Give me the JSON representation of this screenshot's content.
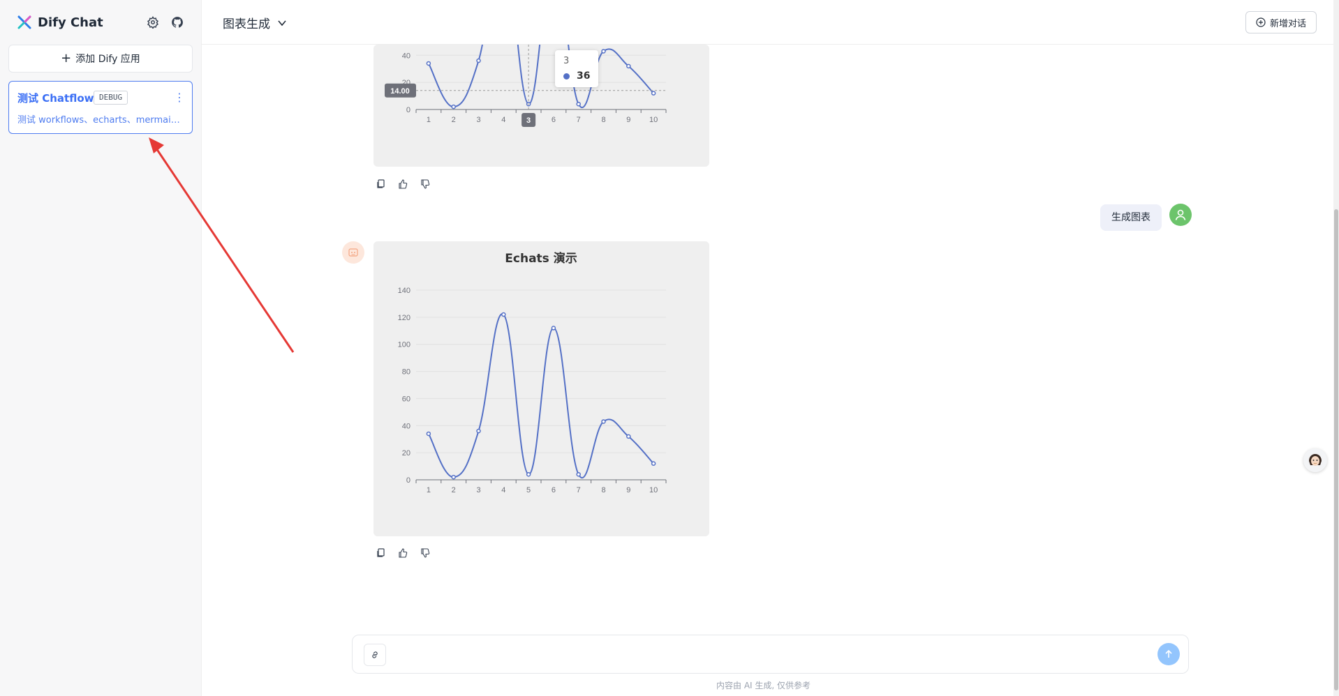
{
  "sidebar": {
    "brand": "Dify Chat",
    "settings_icon": "gear-icon",
    "github_icon": "github-icon",
    "add_app_label": "添加 Dify 应用",
    "app": {
      "title": "测试 Chatflow",
      "badge": "DEBUG",
      "description": "测试 workflows、echarts、mermaid ..."
    }
  },
  "header": {
    "conversation_title": "图表生成",
    "new_chat_label": "新增对话"
  },
  "messages": {
    "user_message": "生成图表"
  },
  "chart_data": [
    {
      "type": "line",
      "title": "",
      "categories": [
        "1",
        "2",
        "3",
        "4",
        "5",
        "6",
        "7",
        "8",
        "9",
        "10"
      ],
      "values": [
        34,
        2,
        36,
        122,
        4,
        112,
        4,
        43,
        32,
        12
      ],
      "ylim": [
        0,
        140
      ],
      "visible_y_ticks": [
        "20",
        "40"
      ],
      "tooltip": {
        "x": "3",
        "value": "36"
      },
      "crosshair_y_label": "14.00",
      "crosshair_x_label": "3",
      "color": "#5470c6"
    },
    {
      "type": "line",
      "title": "Echats 演示",
      "categories": [
        "1",
        "2",
        "3",
        "4",
        "5",
        "6",
        "7",
        "8",
        "9",
        "10"
      ],
      "values": [
        34,
        2,
        36,
        122,
        4,
        112,
        4,
        43,
        32,
        12
      ],
      "ylim": [
        0,
        140
      ],
      "y_ticks": [
        0,
        20,
        40,
        60,
        80,
        100,
        120,
        140
      ],
      "grid": true,
      "color": "#5470c6"
    }
  ],
  "input": {
    "placeholder": "",
    "disclaimer": "内容由 AI 生成, 仅供参考"
  },
  "colors": {
    "accent": "#3b6ff5",
    "series": "#5470c6",
    "user_avatar": "#6cc46b",
    "send_button": "#93c5fd"
  }
}
